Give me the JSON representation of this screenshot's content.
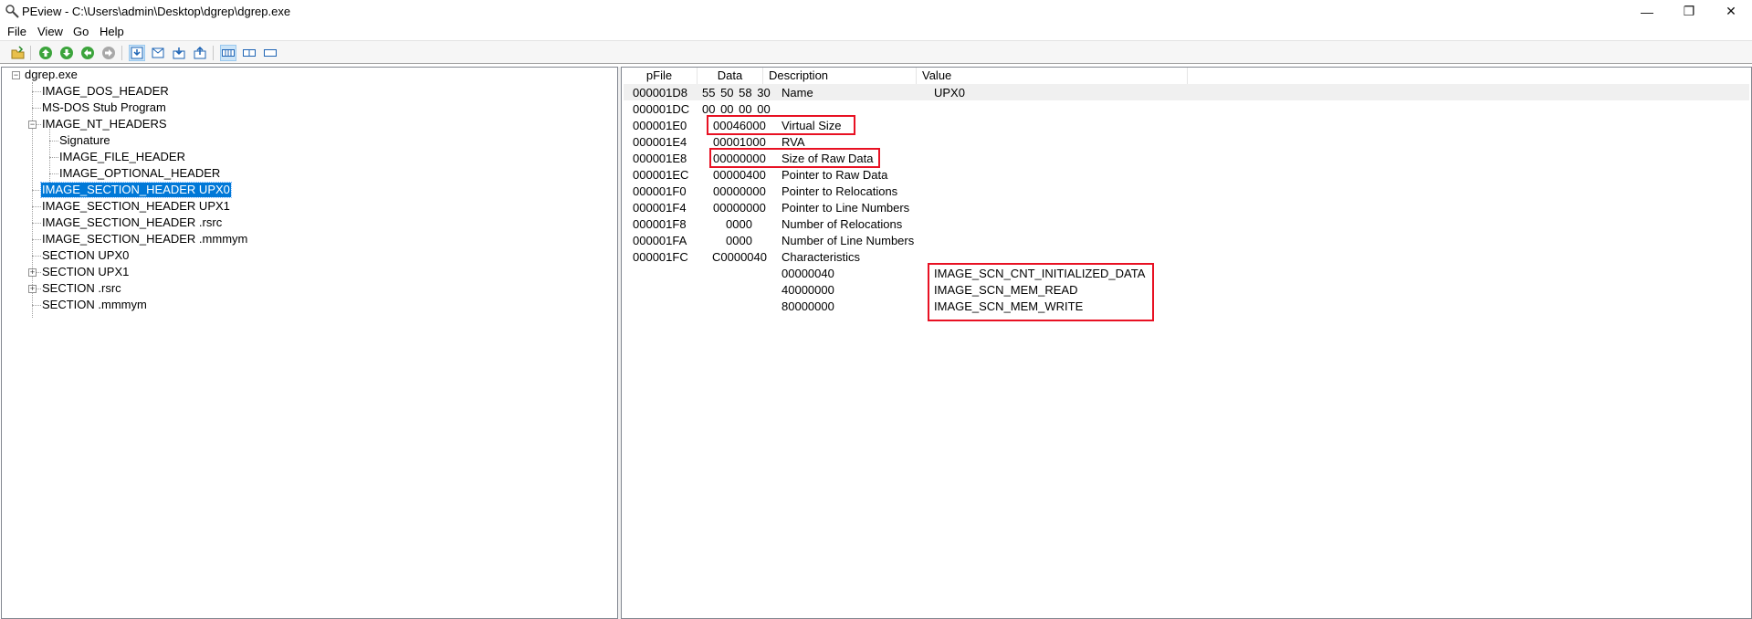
{
  "window": {
    "title": "PEview - C:\\Users\\admin\\Desktop\\dgrep\\dgrep.exe",
    "minimize_glyph": "—",
    "maximize_glyph": "❐",
    "close_glyph": "✕"
  },
  "menu": [
    "File",
    "View",
    "Go",
    "Help"
  ],
  "toolbar": {
    "icons": [
      "open-file-icon",
      "back-icon",
      "forward-icon",
      "previous-icon",
      "next-icon",
      "section-icon",
      "header-icon",
      "import-icon",
      "export-icon",
      "view-byte-icon",
      "view-word-icon",
      "view-dword-icon"
    ]
  },
  "tree": {
    "root": "dgrep.exe",
    "items": [
      "IMAGE_DOS_HEADER",
      "MS-DOS Stub Program",
      "IMAGE_NT_HEADERS",
      "Signature",
      "IMAGE_FILE_HEADER",
      "IMAGE_OPTIONAL_HEADER",
      "IMAGE_SECTION_HEADER UPX0",
      "IMAGE_SECTION_HEADER UPX1",
      "IMAGE_SECTION_HEADER .rsrc",
      "IMAGE_SECTION_HEADER .mmmym",
      "SECTION UPX0",
      "SECTION UPX1",
      "SECTION .rsrc",
      "SECTION .mmmym"
    ],
    "selected": "IMAGE_SECTION_HEADER UPX0"
  },
  "table": {
    "columns": [
      "pFile",
      "Data",
      "Description",
      "Value"
    ],
    "rows": [
      {
        "pfile": "000001D8",
        "data": "55  50  58  30",
        "desc": "Name",
        "value": "UPX0"
      },
      {
        "pfile": "000001DC",
        "data": "00  00  00  00",
        "desc": "",
        "value": ""
      },
      {
        "pfile": "000001E0",
        "data": "00046000",
        "desc": "Virtual Size",
        "value": ""
      },
      {
        "pfile": "000001E4",
        "data": "00001000",
        "desc": "RVA",
        "value": ""
      },
      {
        "pfile": "000001E8",
        "data": "00000000",
        "desc": "Size of Raw Data",
        "value": ""
      },
      {
        "pfile": "000001EC",
        "data": "00000400",
        "desc": "Pointer to Raw Data",
        "value": ""
      },
      {
        "pfile": "000001F0",
        "data": "00000000",
        "desc": "Pointer to Relocations",
        "value": ""
      },
      {
        "pfile": "000001F4",
        "data": "00000000",
        "desc": "Pointer to Line Numbers",
        "value": ""
      },
      {
        "pfile": "000001F8",
        "data": "0000",
        "desc": "Number of Relocations",
        "value": ""
      },
      {
        "pfile": "000001FA",
        "data": "0000",
        "desc": "Number of Line Numbers",
        "value": ""
      },
      {
        "pfile": "000001FC",
        "data": "C0000040",
        "desc": "Characteristics",
        "value": ""
      },
      {
        "pfile": "",
        "data": "",
        "desc": "00000040",
        "value": "IMAGE_SCN_CNT_INITIALIZED_DATA"
      },
      {
        "pfile": "",
        "data": "",
        "desc": "40000000",
        "value": "IMAGE_SCN_MEM_READ"
      },
      {
        "pfile": "",
        "data": "",
        "desc": "80000000",
        "value": "IMAGE_SCN_MEM_WRITE"
      }
    ]
  },
  "colors": {
    "selection": "#0078d7",
    "highlight_box": "#e81123"
  }
}
